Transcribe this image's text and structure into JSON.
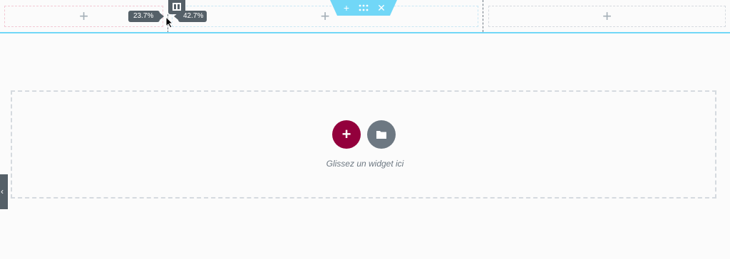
{
  "section": {
    "handle": {
      "add_glyph": "+",
      "move_icon": "drag-handle-icon",
      "close_glyph": "✕"
    }
  },
  "columns": [
    {
      "name": "left",
      "plus_glyph": "+"
    },
    {
      "name": "middle",
      "plus_glyph": "+"
    },
    {
      "name": "right",
      "plus_glyph": "+"
    }
  ],
  "resize": {
    "left_width": "23.7%",
    "right_width": "42.7%"
  },
  "dropzone": {
    "add_glyph": "+",
    "template_icon": "folder-icon",
    "text": "Glissez un widget ici"
  },
  "panel_toggle": {
    "glyph": "‹"
  },
  "colors": {
    "accent_section": "#71d7f7",
    "add_button": "#93003c",
    "template_button": "#6d7882",
    "tag_bg": "#556068"
  }
}
